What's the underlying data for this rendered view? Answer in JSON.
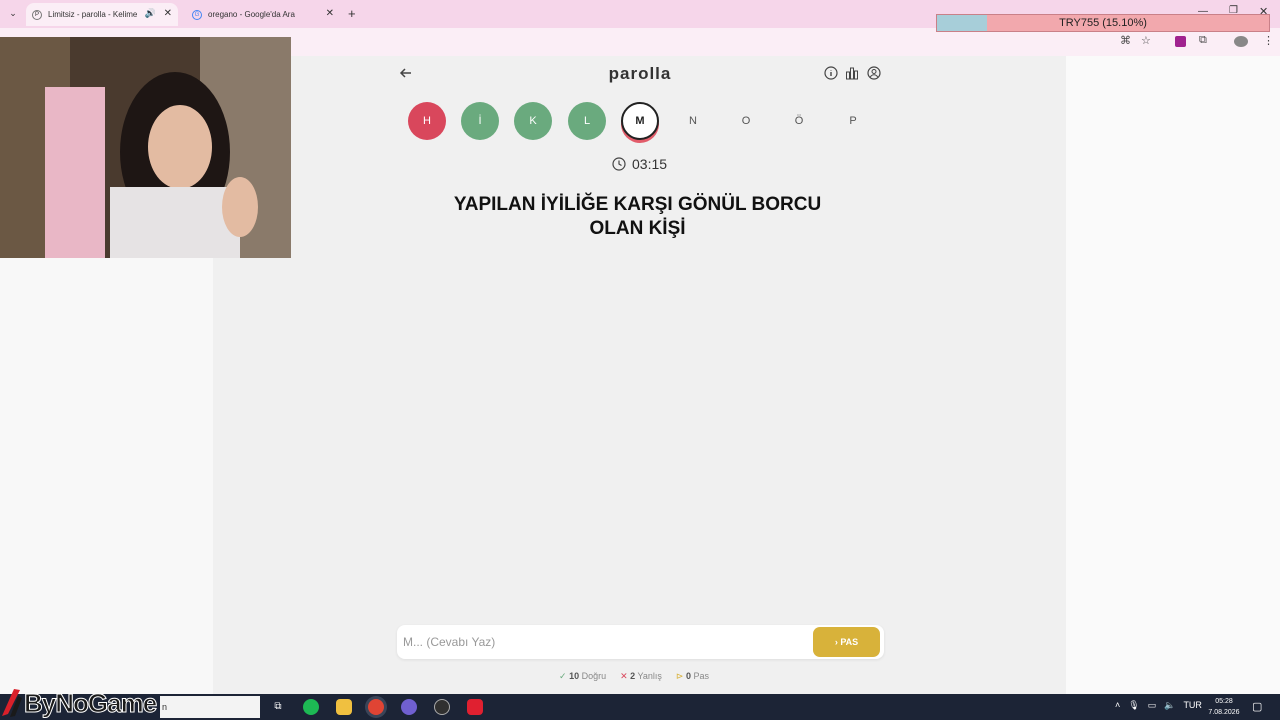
{
  "browser": {
    "tabs": [
      {
        "title": "Limitsiz - parolla - Kelime o",
        "active": true
      },
      {
        "title": "oregano - Google'da Ara",
        "active": false
      }
    ],
    "new_tab": "+"
  },
  "ticker": {
    "label": "TRY755 (15.10%)",
    "progress_fraction": 0.151
  },
  "app": {
    "title": "parolla",
    "letters": [
      {
        "char": "H",
        "state": "wrong"
      },
      {
        "char": "İ",
        "state": "correct"
      },
      {
        "char": "K",
        "state": "correct"
      },
      {
        "char": "L",
        "state": "correct"
      },
      {
        "char": "M",
        "state": "current"
      },
      {
        "char": "N",
        "state": "pending"
      },
      {
        "char": "O",
        "state": "pending"
      },
      {
        "char": "Ö",
        "state": "pending"
      },
      {
        "char": "P",
        "state": "pending"
      }
    ],
    "timer": "03:15",
    "question_line1": "YAPILAN İYİLİĞE KARŞI GÖNÜL BORCU",
    "question_line2": "OLAN KİŞİ",
    "answer_placeholder": "M... (Cevabı Yaz)",
    "pass_label": "PAS",
    "stats": {
      "correct_count": "10",
      "correct_label": "Doğru",
      "wrong_count": "2",
      "wrong_label": "Yanlış",
      "pass_count": "0",
      "pass_label": "Pas"
    },
    "colors": {
      "wrong": "#d9475c",
      "correct": "#6aaa7e",
      "pass": "#d8b23a"
    }
  },
  "taskbar": {
    "search_text": "n",
    "language": "TUR",
    "time": "05:28",
    "date": "7.08.2026"
  },
  "watermark": "ByNoGame"
}
